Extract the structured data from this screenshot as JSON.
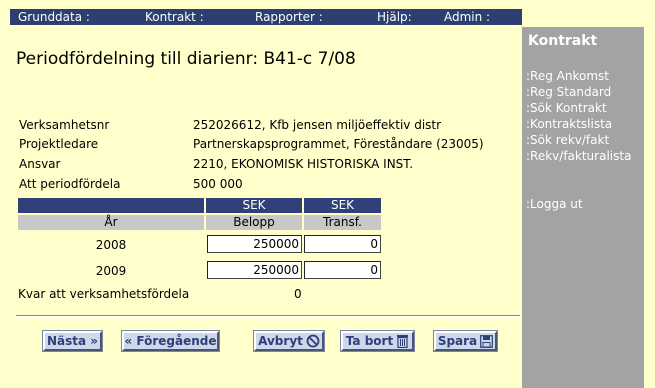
{
  "nav": {
    "items": [
      "Grunddata :",
      "Kontrakt :",
      "Rapporter :",
      "Hjälp:",
      "Admin :"
    ]
  },
  "sidebar": {
    "heading": "Kontrakt",
    "links": [
      ":Reg Ankomst",
      ":Reg Standard",
      ":Sök Kontrakt",
      ":Kontraktslista",
      ":Sök rekv/fakt",
      ":Rekv/fakturalista"
    ],
    "logout": ":Logga ut"
  },
  "page": {
    "title": "Periodfördelning till diarienr: B41-c 7/08"
  },
  "info": [
    {
      "label": "Verksamhetsnr",
      "value": "252026612, Kfb jensen miljöeffektiv distr"
    },
    {
      "label": "Projektledare",
      "value": "Partnerskapsprogrammet, Föreståndare (23005)"
    },
    {
      "label": "Ansvar",
      "value": "2210, EKONOMISK HISTORISKA INST."
    },
    {
      "label": "Att periodfördela",
      "value": "500 000"
    }
  ],
  "table": {
    "currency_1": "SEK",
    "currency_2": "SEK",
    "col_year": "År",
    "col_amount": "Belopp",
    "col_transf": "Transf.",
    "rows": [
      {
        "year": "2008",
        "amount": "250000",
        "transf": "0"
      },
      {
        "year": "2009",
        "amount": "250000",
        "transf": "0"
      }
    ],
    "remaining_label": "Kvar att verksamhetsfördela",
    "remaining_value": "0"
  },
  "buttons": {
    "next": "Nästa »",
    "prev": "« Föregående",
    "cancel": "Avbryt",
    "delete": "Ta bort",
    "save": "Spara"
  },
  "colors": {
    "background": "#ffffcc",
    "nav_bar": "#2d3f70",
    "sidebar": "#a3a3a3",
    "table_header": "#32407a",
    "button_text": "#2b3f7a"
  }
}
